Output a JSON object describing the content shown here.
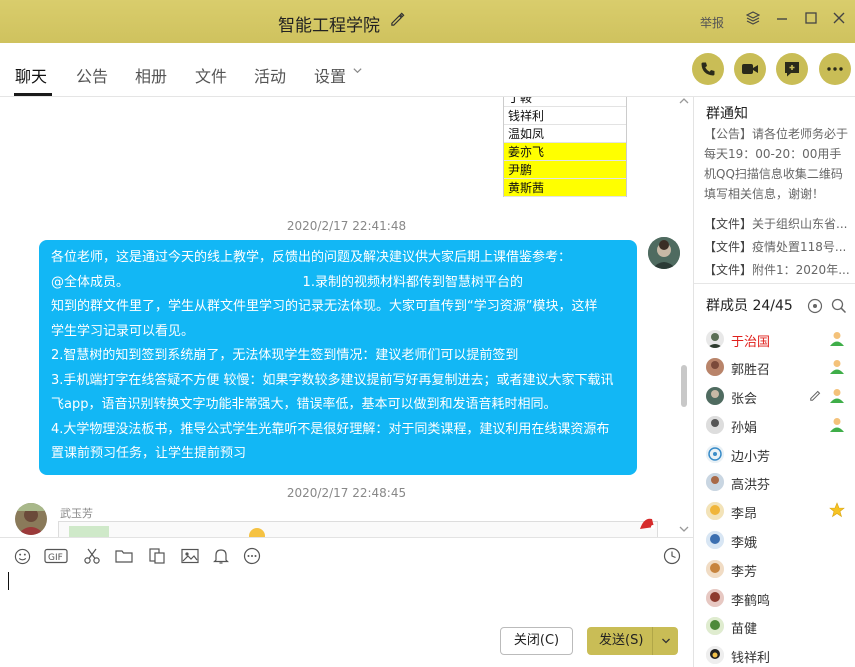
{
  "window": {
    "title": "智能工程学院",
    "report": "举报"
  },
  "tabs": [
    "聊天",
    "公告",
    "相册",
    "文件",
    "活动",
    "设置"
  ],
  "chat": {
    "sheet_rows": [
      {
        "name": "丁鞍",
        "highlight": false
      },
      {
        "name": "钱祥利",
        "highlight": false
      },
      {
        "name": "温如凤",
        "highlight": false
      },
      {
        "name": "姜亦飞",
        "highlight": true
      },
      {
        "name": "尹鹏",
        "highlight": true
      },
      {
        "name": "黄斯茜",
        "highlight": true
      }
    ],
    "timestamp1": "2020/2/17 22:41:48",
    "message_lines": [
      "各位老师，这是通过今天的线上教学，反馈出的问题及解决建议供大家后期上课借鉴参考：",
      "@全体成员。                                          1.录制的视频材料都传到智慧树平台的",
      "知到的群文件里了，学生从群文件里学习的记录无法体现。大家可直传到“学习资源”模块，这样",
      "学生学习记录可以看见。",
      "2.智慧树的知到签到系统崩了，无法体现学生签到情况：建议老师们可以提前签到",
      "3.手机端打字在线答疑不方便 较慢：如果字数较多建议提前写好再复制进去；或者建议大家下载讯",
      "飞app，语音识别转换文字功能非常强大，错误率低，基本可以做到和发语音耗时相同。",
      "4.大学物理没法板书，推导公式学生光靠听不是很好理解：对于同类课程，建议利用在线课资源布",
      "置课前预习任务，让学生提前预习"
    ],
    "timestamp2": "2020/2/17 22:48:45",
    "sender2": "武玉芳"
  },
  "input": {
    "close_label": "关闭(C)",
    "send_label": "发送(S)"
  },
  "notice": {
    "title": "群通知",
    "text": "【公告】请各位老师务必于每天19：00-20：00用手机QQ扫描信息收集二维码填写相关信息，谢谢！",
    "files": [
      {
        "tag": "【文件】",
        "name": "关于组织山东省..."
      },
      {
        "tag": "【文件】",
        "name": "疫情处置118号..."
      },
      {
        "tag": "【文件】",
        "name": "附件1：2020年..."
      }
    ]
  },
  "members": {
    "title": "群成员 24/45",
    "list": [
      {
        "name": "于治国",
        "role": "owner",
        "badge": "admin"
      },
      {
        "name": "郭胜召",
        "role": "member",
        "badge": "admin"
      },
      {
        "name": "张会",
        "role": "member",
        "badge": "admin"
      },
      {
        "name": "孙娟",
        "role": "member",
        "badge": "admin"
      },
      {
        "name": "边小芳",
        "role": "member",
        "badge": ""
      },
      {
        "name": "高洪芬",
        "role": "member",
        "badge": ""
      },
      {
        "name": "李昂",
        "role": "member",
        "badge": "star"
      },
      {
        "name": "李娥",
        "role": "member",
        "badge": ""
      },
      {
        "name": "李芳",
        "role": "member",
        "badge": ""
      },
      {
        "name": "李鹤鸣",
        "role": "member",
        "badge": ""
      },
      {
        "name": "苗健",
        "role": "member",
        "badge": ""
      },
      {
        "name": "钱祥利",
        "role": "member",
        "badge": ""
      }
    ]
  },
  "colors": {
    "titlebar": "#d3c764",
    "accent": "#c9bd56",
    "bubble": "#12b7f5",
    "owner": "#e0201c",
    "sheet_highlight": "#ffff00"
  }
}
